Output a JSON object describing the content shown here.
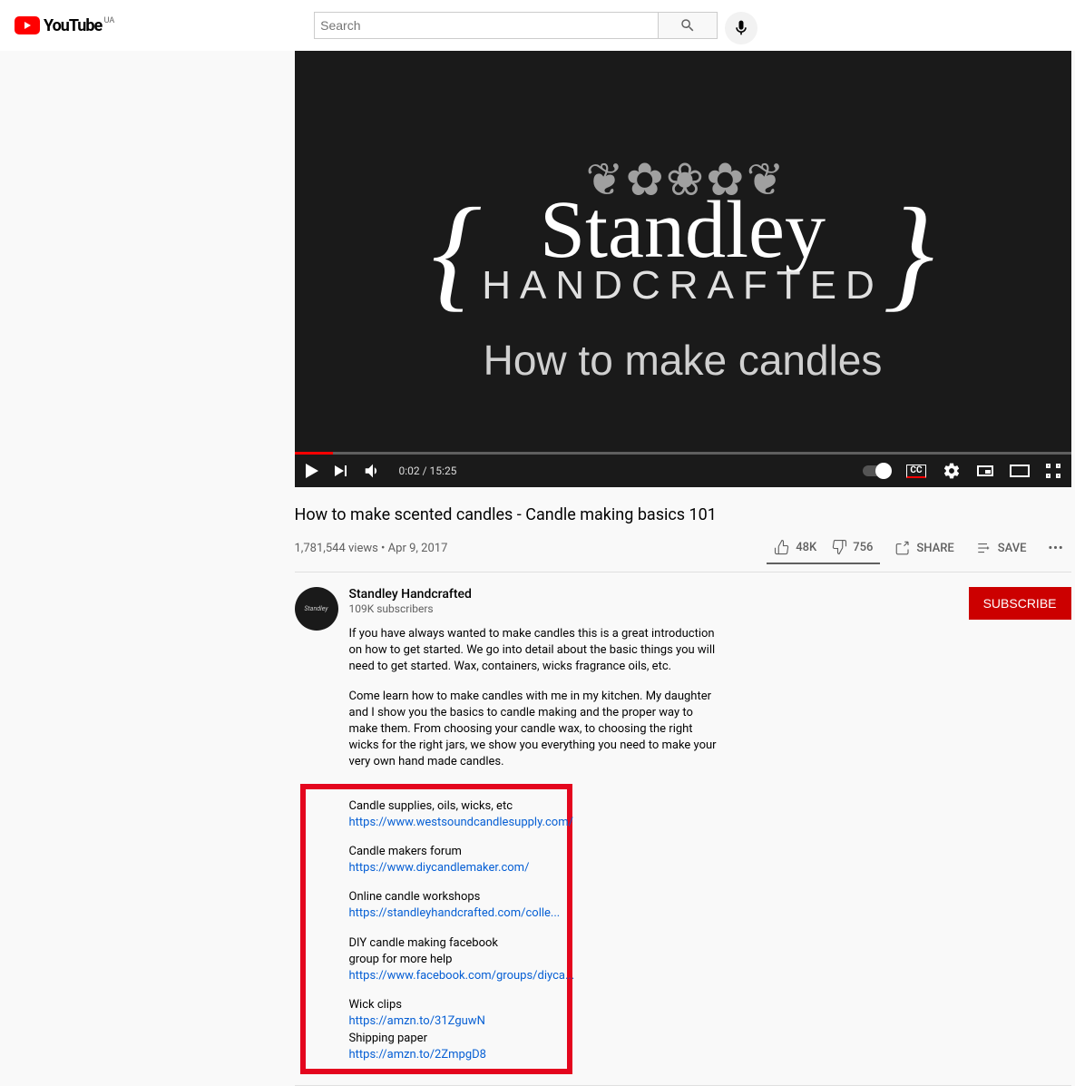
{
  "header": {
    "logo_text": "YouTube",
    "region": "UA",
    "search_placeholder": "Search"
  },
  "player": {
    "brand_main": "Standley",
    "brand_sub": "HANDCRAFTED",
    "subtitle": "How to make candles",
    "time_current": "0:02",
    "time_total": "15:25",
    "cc_label": "CC"
  },
  "video": {
    "title": "How to make scented candles - Candle making basics 101",
    "views": "1,781,544 views",
    "date": "Apr 9, 2017"
  },
  "actions": {
    "likes": "48K",
    "dislikes": "756",
    "share": "SHARE",
    "save": "SAVE"
  },
  "channel": {
    "name": "Standley Handcrafted",
    "subscribers": "109K subscribers",
    "subscribe_btn": "SUBSCRIBE",
    "avatar_text": "Standley"
  },
  "description": {
    "p1": "If you have always wanted to make candles this is a great introduction on how to get started. We go into detail about the basic things you will need to get started. Wax, containers, wicks fragrance oils, etc.",
    "p2": "Come learn how to make candles with me in my kitchen. My daughter and I show you the basics to candle making and the proper way to make them. From choosing your candle wax, to choosing the right wicks for the right jars, we show you everything you need to make your very own hand made candles.",
    "links": {
      "l1_label": "Candle supplies, oils, wicks, etc",
      "l1_url": "https://www.westsoundcandlesupply.com/",
      "l2_label": "Candle makers forum",
      "l2_url": "https://www.diycandlemaker.com/",
      "l3_label": "Online candle workshops",
      "l3_url": "https://standleyhandcrafted.com/colle...",
      "l4_label": "DIY candle making facebook group for more help",
      "l4_url": "https://www.facebook.com/groups/diyca...",
      "l5_label": "Wick clips",
      "l5_url": "https://amzn.to/31ZguwN",
      "l6_label": "Shipping paper",
      "l6_url": "https://amzn.to/2ZmpgD8"
    }
  }
}
